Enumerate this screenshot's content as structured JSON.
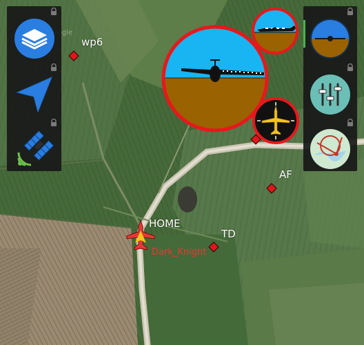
{
  "map": {
    "provider_mark": "Google",
    "waypoints": [
      {
        "label": "wp6"
      },
      {
        "label": "AF"
      },
      {
        "label": "TD"
      },
      {
        "label": "HOME"
      }
    ],
    "vehicle": {
      "label": "Dark_Knight",
      "color": "#e53935"
    }
  },
  "left_toolbar": {
    "items": [
      {
        "icon": "layers-icon",
        "locked": true
      },
      {
        "icon": "navigation-arrow-icon",
        "locked": true
      },
      {
        "icon": "satellite-icon",
        "locked": true
      }
    ]
  },
  "right_toolbar": {
    "items": [
      {
        "icon": "attitude-indicator-icon",
        "locked": true,
        "active": true
      },
      {
        "icon": "sliders-icon",
        "locked": true
      },
      {
        "icon": "map-route-icon",
        "locked": true
      }
    ]
  },
  "instruments": {
    "sky_color": "#19b4f2",
    "ground_color": "#9a6200",
    "ring_color": "#e8171c"
  },
  "colors": {
    "waypoint": "#e1161d",
    "accent_blue": "#2a7de1",
    "active_indicator": "#4caf50"
  }
}
